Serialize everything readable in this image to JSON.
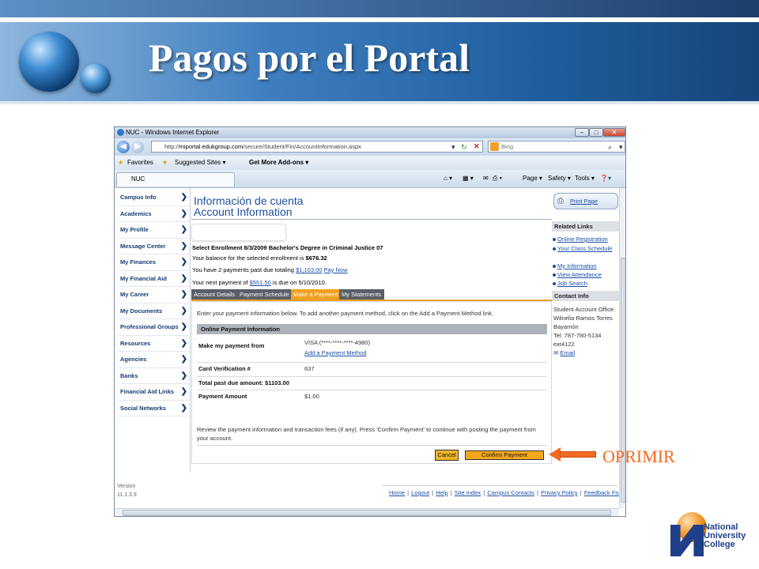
{
  "slide": {
    "title": "Pagos por el Portal",
    "annotation": "OPRIMIR"
  },
  "browser": {
    "window_title": "NUC - Windows Internet Explorer",
    "url_prefix": "http://",
    "url_host": "miportal.edukgroup.com",
    "url_path": "/secure/Student/Fin/AccountInformation.aspx",
    "search_placeholder": "Bing",
    "favorites_label": "Favorites",
    "suggested_sites_label": "Suggested Sites ▾",
    "addons_label": "Get More Add-ons ▾",
    "tab_label": "NUC",
    "commands": {
      "page": "Page ▾",
      "safety": "Safety ▾",
      "tools": "Tools ▾"
    }
  },
  "left_nav": {
    "items": [
      "Campus Info",
      "Academics",
      "My Profile",
      "Message Center",
      "My Finances",
      "My Financial Aid",
      "My Career",
      "My Documents",
      "Professional Groups",
      "Resources",
      "Agencies",
      "Banks",
      "Financial Aid Links",
      "Social Networks"
    ],
    "version_label": "Version",
    "version_number": "11.1.3.9"
  },
  "main": {
    "heading_es": "Información de cuenta",
    "heading_en": "Account Information",
    "enrollment_label": "Select Enrollment 8/3/2009 Bachelor's Degree in Criminal Justice 07",
    "balance_text": "Your balance for the selected enrollment is",
    "balance_amount": "$676.32",
    "past_due_text": "You have 2 payments past due totaling",
    "past_due_amount": "$1,103.00",
    "pay_now": "Pay Now",
    "next_payment_text": "Your next payment of",
    "next_payment_amount": "$551.50",
    "next_payment_due": "is due on 5/10/2010.",
    "tabs": [
      "Account Details",
      "Payment Schedule",
      "Make a Payment",
      "My Statements"
    ],
    "intro": "Enter your payment information below. To add another payment method, click on the Add a Payment Method link.",
    "section_title": "Online Payment Information",
    "make_payment_label": "Make my payment from",
    "payment_method": "VISA (****-****-****-4980)",
    "add_method_link": "Add a Payment Method",
    "card_verification_label": "Card Verification #",
    "card_verification_value": "637",
    "total_past_due_label": "Total past due amount: $1103.00",
    "payment_amount_label": "Payment Amount",
    "payment_amount_value": "$1.00",
    "review_text": "Review the payment information and transaction fees (if any). Press 'Confirm Payment' to continue with posting the payment from your account.",
    "cancel_button": "Cancel",
    "confirm_button": "Confirm Payment"
  },
  "right_col": {
    "print_page": "Print Page",
    "related_links_title": "Related Links",
    "related_links": [
      "Online Registration",
      "Your Class Schedule",
      "My Information",
      "View Attendance",
      "Job Search"
    ],
    "contact_title": "Contact Info",
    "contact_lines": [
      "Student Account Office",
      "Wilnelia Ramos Torres",
      "Bayamón",
      "Tel: 787-780-5134",
      "ext4122"
    ],
    "email_link": "Email"
  },
  "footer_links": [
    "Home",
    "Logout",
    "Help",
    "Site Index",
    "Campus Contacts",
    "Privacy Policy",
    "Feedback Form"
  ],
  "logo": {
    "line1": "National",
    "line2": "University",
    "line3": "College"
  }
}
